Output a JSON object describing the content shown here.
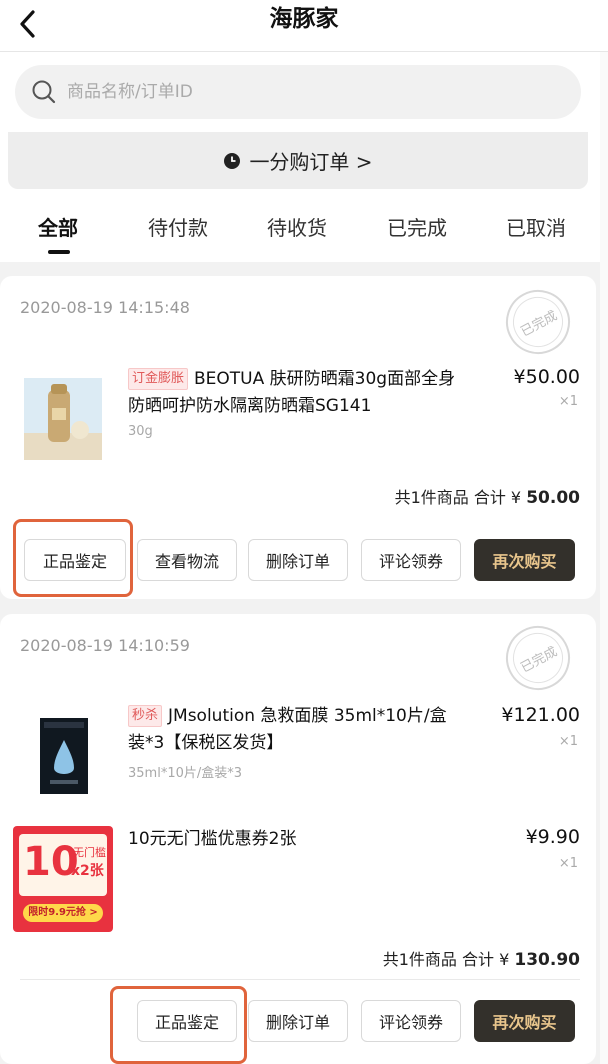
{
  "header": {
    "title": "海豚家",
    "back_icon": "chevron-left-icon"
  },
  "search": {
    "placeholder": "商品名称/订单ID",
    "icon": "search-icon"
  },
  "yifen": {
    "label": "一分购订单 >",
    "icon": "clock-icon"
  },
  "tabs": [
    {
      "label": "全部",
      "active": true
    },
    {
      "label": "待付款",
      "active": false
    },
    {
      "label": "待收货",
      "active": false
    },
    {
      "label": "已完成",
      "active": false
    },
    {
      "label": "已取消",
      "active": false
    }
  ],
  "orders": [
    {
      "date": "2020-08-19 14:15:48",
      "stamp": "已完成",
      "items": [
        {
          "tag": "订金膨胀",
          "name": "BEOTUA 肤研防晒霜30g面部全身防晒呵护防水隔离防晒霜SG141",
          "spec": "30g",
          "price": "¥50.00",
          "qty": "×1"
        }
      ],
      "total": {
        "count_text": "共1件商品 合计 ¥",
        "amount": "50.00"
      },
      "buttons": [
        "正品鉴定",
        "查看物流",
        "删除订单",
        "评论领券",
        "再次购买"
      ]
    },
    {
      "date": "2020-08-19 14:10:59",
      "stamp": "已完成",
      "items": [
        {
          "tag": "秒杀",
          "name": "JMsolution 急救面膜 35ml*10片/盒装*3【保税区发货】",
          "spec": "35ml*10片/盒装*3",
          "price": "¥121.00",
          "qty": "×1"
        },
        {
          "tag": "",
          "name": "10元无门槛优惠券2张",
          "spec": "",
          "price": "¥9.90",
          "qty": "×1",
          "coupon": {
            "value": "10",
            "label_top": "无门槛",
            "label_mult": "x2张",
            "label_bottom": "限时9.9元抢 >"
          }
        }
      ],
      "total": {
        "count_text": "共1件商品 合计 ¥",
        "amount": "130.90"
      },
      "buttons": [
        "正品鉴定",
        "删除订单",
        "评论领券",
        "再次购买"
      ]
    }
  ],
  "colors": {
    "accent_dark": "#33302b",
    "accent_gold": "#e8c58c",
    "highlight": "#e0643c",
    "tag_red": "#e05a5a"
  }
}
